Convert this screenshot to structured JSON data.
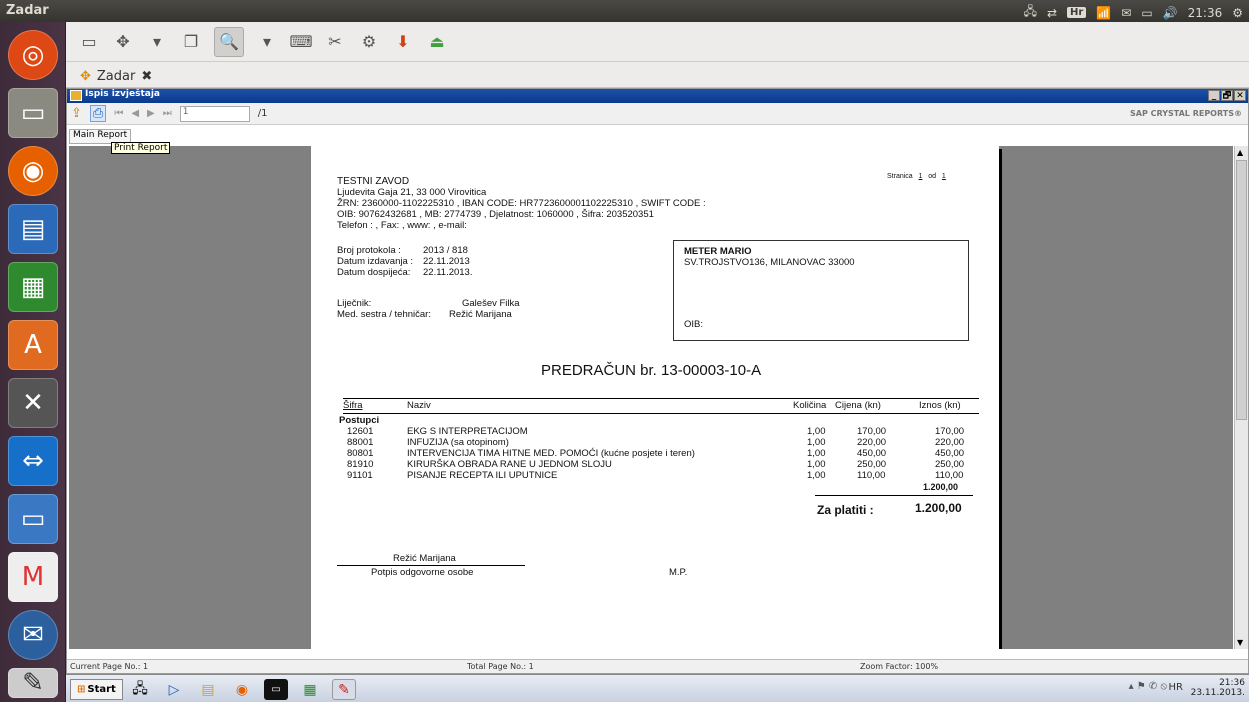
{
  "topbar": {
    "title": "Zadar",
    "tray_lang": "Hr",
    "time": "21:36"
  },
  "app": {
    "tab_label": "Zadar"
  },
  "window": {
    "title": "Ispis izvještaja",
    "min": "_",
    "max": "🗗",
    "close": "✕"
  },
  "crtoolbar": {
    "page_value": "1",
    "page_total": "/1",
    "brand": "SAP CRYSTAL REPORTS®"
  },
  "report_tab": "Main Report",
  "tooltip": "Print Report",
  "document": {
    "org_name": "TESTNI ZAVOD",
    "org_address": "Ljudevita Gaja 21, 33 000 Virovitica",
    "org_bank": "ŽRN: 2360000-1102225310 , IBAN CODE: HR7723600001102225310 , SWIFT CODE :",
    "org_ids": "OIB: 90762432681 , MB: 2774739 , Djelatnost: 1060000 , Šifra: 203520351",
    "org_contact": "Telefon : , Fax: , www: , e-mail:",
    "page_label": "Stranica",
    "page_no": "1",
    "page_of": "od",
    "page_total": "1",
    "meta": [
      {
        "label": "Broj protokola :",
        "value": "2013 / 818"
      },
      {
        "label": "Datum izdavanja :",
        "value": "22.11.2013"
      },
      {
        "label": "Datum dospijeća:",
        "value": "22.11.2013."
      }
    ],
    "doctor_label": "Liječnik:",
    "doctor": "Galešev Filka",
    "nurse_label": "Med. sestra / tehničar:",
    "nurse": "Režić Marijana",
    "client_name": "METER MARIO",
    "client_address": "SV.TROJSTVO136, MILANOVAC 33000",
    "client_oib": "OIB:",
    "heading": "PREDRAČUN br. 13-00003-10-A",
    "columns": {
      "sifra": "Šifra",
      "naziv": "Naziv",
      "kolicina": "Količina",
      "cijena": "Cijena (kn)",
      "iznos": "Iznos (kn)"
    },
    "group": "Postupci",
    "items": [
      {
        "sifra": "12601",
        "naziv": "EKG S INTERPRETACIJOM",
        "kolicina": "1,00",
        "cijena": "170,00",
        "iznos": "170,00"
      },
      {
        "sifra": "88001",
        "naziv": "INFUZIJA (sa otopinom)",
        "kolicina": "1,00",
        "cijena": "220,00",
        "iznos": "220,00"
      },
      {
        "sifra": "80801",
        "naziv": "INTERVENCIJA TIMA HITNE MED. POMOĆI (kućne posjete i teren)",
        "kolicina": "1,00",
        "cijena": "450,00",
        "iznos": "450,00"
      },
      {
        "sifra": "81910",
        "naziv": "KIRURŠKA OBRADA RANE U JEDNOM SLOJU",
        "kolicina": "1,00",
        "cijena": "250,00",
        "iznos": "250,00"
      },
      {
        "sifra": "91101",
        "naziv": "PISANJE RECEPTA ILI UPUTNICE",
        "kolicina": "1,00",
        "cijena": "110,00",
        "iznos": "110,00"
      }
    ],
    "subtotal": "1.200,00",
    "total_label": "Za platiti :",
    "total": "1.200,00",
    "signer": "Režić Marijana",
    "signature_label": "Potpis odgovorne osobe",
    "stamp_label": "M.P."
  },
  "status": {
    "current": "Current Page No.: 1",
    "total": "Total Page No.: 1",
    "zoom": "Zoom Factor: 100%"
  },
  "taskbar": {
    "start": "Start",
    "lang": "HR",
    "time": "21:36",
    "date": "23.11.2013."
  }
}
